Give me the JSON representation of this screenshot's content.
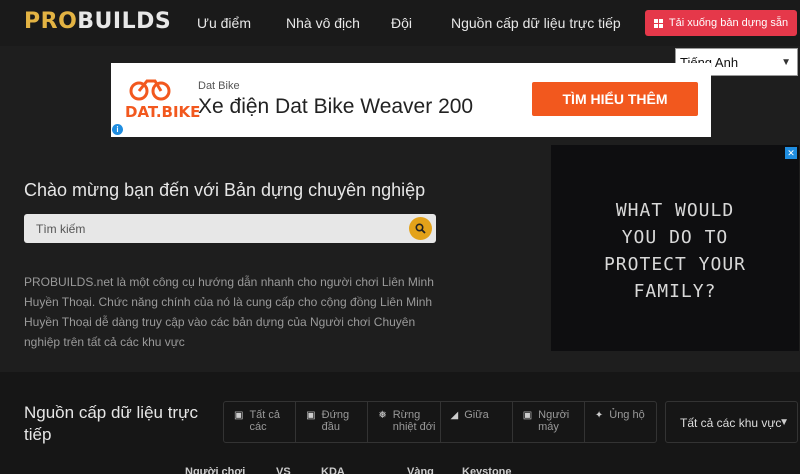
{
  "nav": {
    "logo_part1": "PRO",
    "logo_part2": "BUILDS",
    "links": [
      "Ưu điểm",
      "Nhà vô địch",
      "Đội",
      "Nguồn cấp dữ liệu trực tiếp"
    ],
    "download_label": "Tải xuống bản dựng sẵn",
    "download_color": "#e5384a"
  },
  "language": {
    "selected": "Tiếng Anh"
  },
  "ad_banner": {
    "logo_text": "DAT.BIKE",
    "brand": "Dat Bike",
    "headline": "Xe điện Dat Bike Weaver 200",
    "cta": "TÌM HIỂU THÊM",
    "accent": "#f2581e"
  },
  "side_ad": {
    "message": "WHAT WOULD\nYOU DO TO\nPROTECT YOUR\nFAMILY?"
  },
  "hero": {
    "welcome": "Chào mừng bạn đến với Bản dựng chuyên nghiệp",
    "search_placeholder": "Tìm kiếm",
    "description": "PROBUILDS.net là một công cụ hướng dẫn nhanh cho người chơi Liên Minh Huyền Thoại. Chức năng chính của nó là cung cấp cho cộng đồng Liên Minh Huyền Thoại dễ dàng truy cập vào các bản dựng của Người chơi Chuyên nghiệp trên tất cả các khu vực"
  },
  "feed": {
    "title": "Nguồn cấp dữ liệu trực tiếp",
    "filters": [
      {
        "label": "Tất cả các",
        "icon": "all-roles-icon"
      },
      {
        "label": "Đứng đầu",
        "icon": "top-lane-icon"
      },
      {
        "label": "Rừng nhiệt đới",
        "icon": "jungle-icon"
      },
      {
        "label": "Giữa",
        "icon": "mid-lane-icon"
      },
      {
        "label": "Người máy",
        "icon": "bot-lane-icon"
      },
      {
        "label": "Ủng hộ",
        "icon": "support-icon"
      }
    ],
    "region": "Tất cả các khu vực",
    "columns": [
      "Người chơi",
      "VS",
      "KDA",
      "Vàng",
      "Keystone"
    ]
  }
}
